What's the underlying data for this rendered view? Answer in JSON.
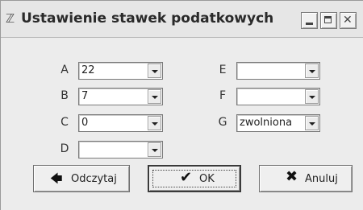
{
  "window": {
    "title": "Ustawienie stawek podatkowych",
    "app_icon": "ruler-icon"
  },
  "fields": {
    "A": {
      "label": "A",
      "value": "22"
    },
    "B": {
      "label": "B",
      "value": "7"
    },
    "C": {
      "label": "C",
      "value": "0"
    },
    "D": {
      "label": "D",
      "value": ""
    },
    "E": {
      "label": "E",
      "value": ""
    },
    "F": {
      "label": "F",
      "value": ""
    },
    "G": {
      "label": "G",
      "value": "zwolniona"
    }
  },
  "buttons": {
    "read": {
      "label": "Odczytaj",
      "icon": "arrow-left-icon"
    },
    "ok": {
      "label": "OK",
      "icon": "checkmark-icon"
    },
    "cancel": {
      "label": "Anuluj",
      "icon": "x-mark-icon"
    }
  }
}
